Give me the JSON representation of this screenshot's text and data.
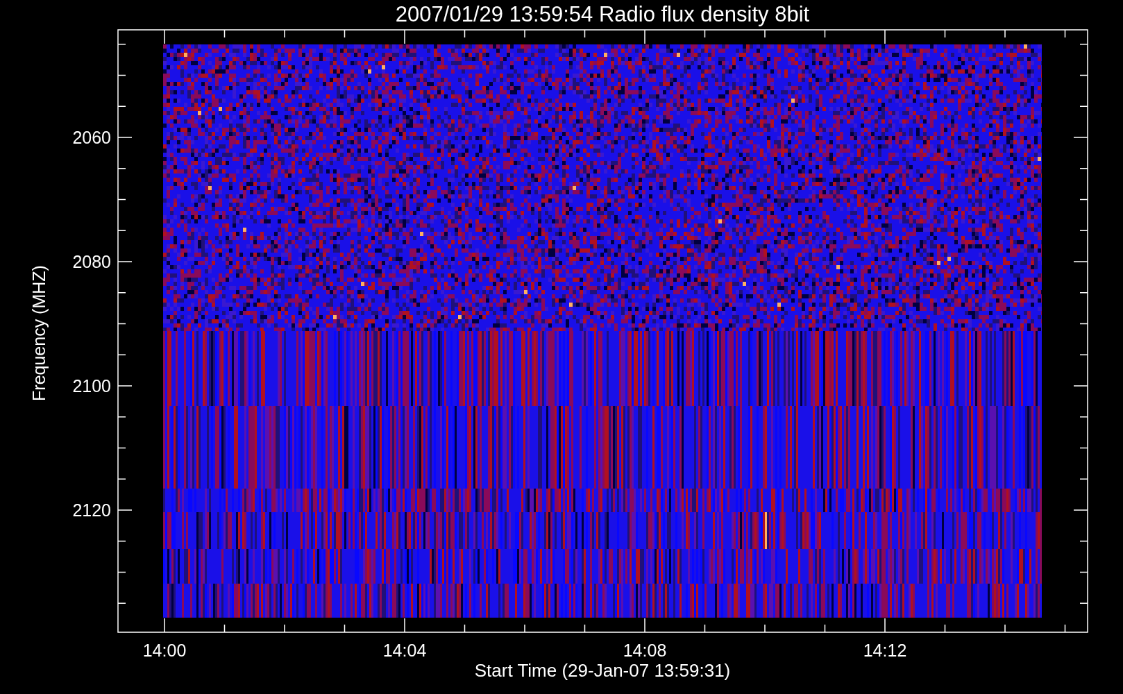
{
  "title": "2007/01/29 13:59:54 Radio flux density 8bit",
  "y_axis": {
    "label": "Frequency (MHZ)",
    "ticks": [
      "2060",
      "2080",
      "2100",
      "2120"
    ]
  },
  "x_axis": {
    "label": "Start Time (29-Jan-07 13:59:31)",
    "ticks": [
      "14:00",
      "14:04",
      "14:08",
      "14:12"
    ]
  }
}
